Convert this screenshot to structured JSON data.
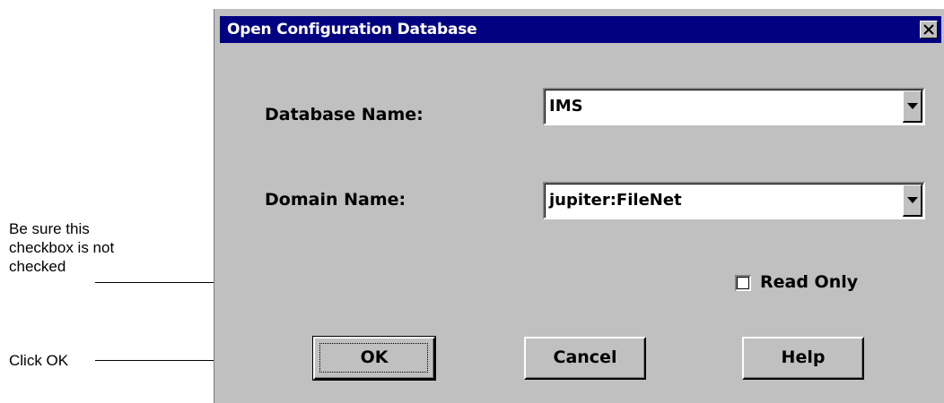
{
  "annotations": {
    "checkbox_note": [
      "Be sure this",
      "checkbox is not",
      "checked"
    ],
    "ok_note": "Click OK"
  },
  "dialog": {
    "title": "Open Configuration Database",
    "close_icon": "close-icon",
    "database_name": {
      "label": "Database Name:",
      "value": "IMS"
    },
    "domain_name": {
      "label": "Domain Name:",
      "value": "jupiter:FileNet"
    },
    "read_only": {
      "label": "Read Only",
      "checked": false
    },
    "buttons": {
      "ok": "OK",
      "cancel": "Cancel",
      "help": "Help"
    }
  },
  "colors": {
    "titlebar": "#000080",
    "face": "#c0c0c0"
  }
}
